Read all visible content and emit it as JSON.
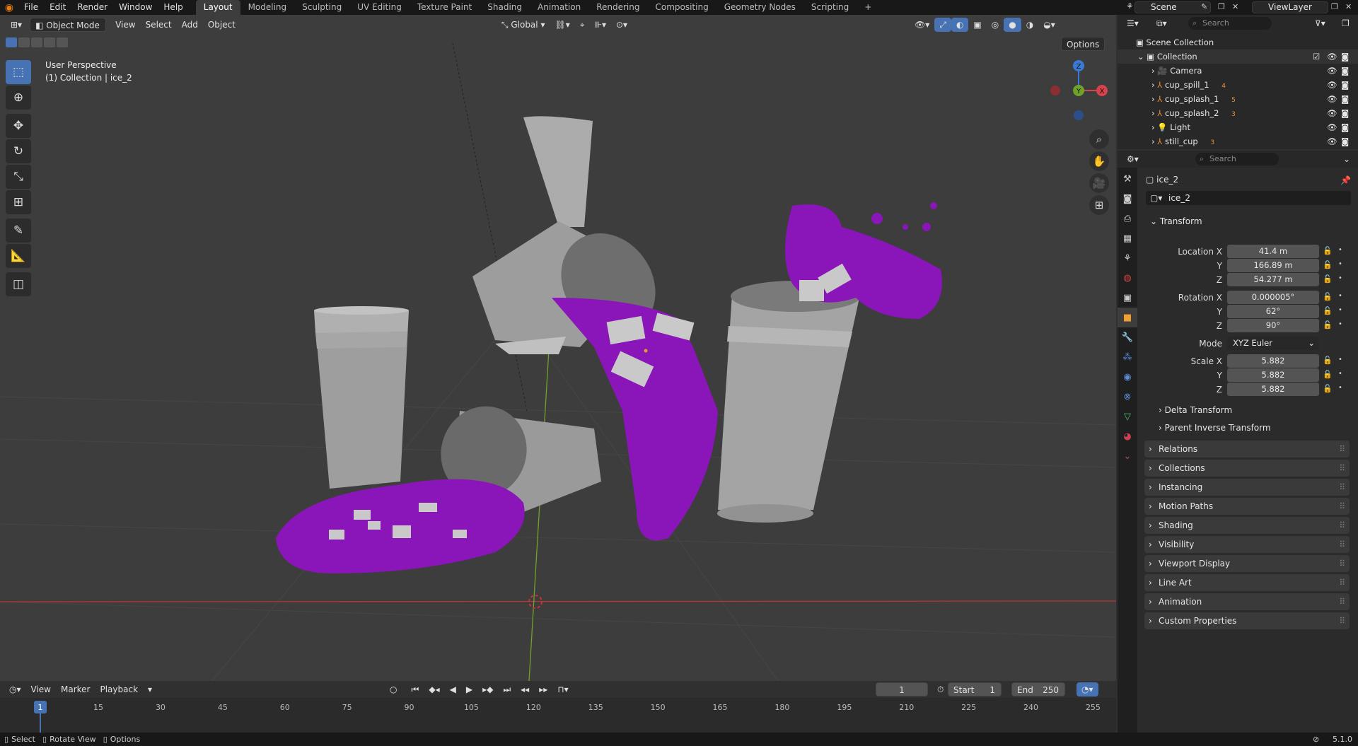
{
  "menu": [
    "File",
    "Edit",
    "Render",
    "Window",
    "Help"
  ],
  "workspaces": [
    "Layout",
    "Modeling",
    "Sculpting",
    "UV Editing",
    "Texture Paint",
    "Shading",
    "Animation",
    "Rendering",
    "Compositing",
    "Geometry Nodes",
    "Scripting"
  ],
  "active_workspace": "Layout",
  "scene_name": "Scene",
  "view_layer": "ViewLayer",
  "viewport": {
    "mode": "Object Mode",
    "menus": [
      "View",
      "Select",
      "Add",
      "Object"
    ],
    "transform_orientation": "Global",
    "options_label": "Options",
    "view_name": "User Perspective",
    "collection_info": "(1) Collection | ice_2",
    "gizmo_axes": [
      "Z",
      "Y",
      "X"
    ]
  },
  "timeline": {
    "menus": [
      "View",
      "Marker",
      "Playback"
    ],
    "current_frame": "1",
    "start_label": "Start",
    "start": "1",
    "end_label": "End",
    "end": "250",
    "ticks": [
      "1",
      "15",
      "30",
      "45",
      "60",
      "75",
      "90",
      "105",
      "120",
      "135",
      "150",
      "165",
      "180",
      "195",
      "210",
      "225",
      "240",
      "255"
    ]
  },
  "statusbar": {
    "select": "Select",
    "rotate": "Rotate View",
    "options": "Options",
    "version": "5.1.0"
  },
  "outliner": {
    "search_placeholder": "Search",
    "root": "Scene Collection",
    "collection": "Collection",
    "items": [
      {
        "name": "Camera",
        "icon": "camera-icon"
      },
      {
        "name": "cup_spill_1",
        "icon": "mesh-icon",
        "badge": "4"
      },
      {
        "name": "cup_splash_1",
        "icon": "mesh-icon",
        "badge": "5"
      },
      {
        "name": "cup_splash_2",
        "icon": "mesh-icon",
        "badge": "3"
      },
      {
        "name": "Light",
        "icon": "light-icon"
      },
      {
        "name": "still_cup",
        "icon": "mesh-icon",
        "badge": "3"
      }
    ]
  },
  "properties": {
    "search_placeholder": "Search",
    "object_name": "ice_2",
    "datablock_name": "ice_2",
    "transform_label": "Transform",
    "location": {
      "label": "Location X",
      "x": "41.4 m",
      "y": "166.89 m",
      "z": "54.277 m"
    },
    "rotation": {
      "label": "Rotation X",
      "x": "0.000005°",
      "y": "62°",
      "z": "90°"
    },
    "mode_label": "Mode",
    "mode": "XYZ Euler",
    "scale": {
      "label": "Scale X",
      "x": "5.882",
      "y": "5.882",
      "z": "5.882"
    },
    "axis_y": "Y",
    "axis_z": "Z",
    "subpanels": [
      "Delta Transform",
      "Parent Inverse Transform"
    ],
    "panels": [
      "Relations",
      "Collections",
      "Instancing",
      "Motion Paths",
      "Shading",
      "Visibility",
      "Viewport Display",
      "Line Art",
      "Animation",
      "Custom Properties"
    ]
  },
  "colors": {
    "accent": "#4772b3",
    "liquid": "#8a15b8",
    "cup": "#b8b8b8"
  }
}
